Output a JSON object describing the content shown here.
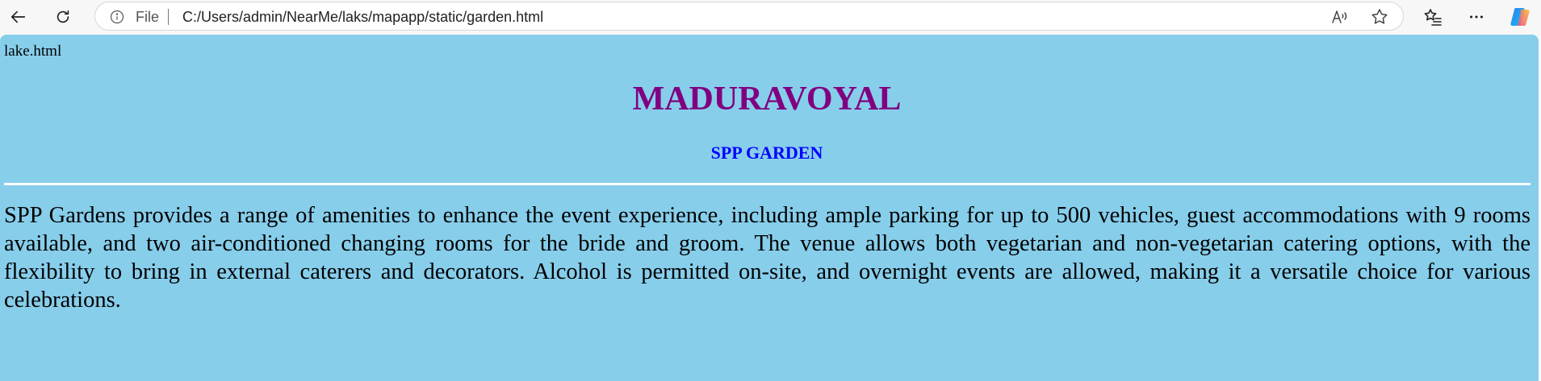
{
  "browser": {
    "file_label": "File",
    "url": "C:/Users/admin/NearMe/laks/mapapp/static/garden.html"
  },
  "page": {
    "filename": "lake.html",
    "title": "MADURAVOYAL",
    "subtitle": "SPP GARDEN",
    "body": "SPP Gardens provides a range of amenities to enhance the event experience, including ample parking for up to 500 vehicles, guest accommodations with 9 rooms available, and two air-conditioned changing rooms for the bride and groom. The venue allows both vegetarian and non-vegetarian catering options, with the flexibility to bring in external caterers and decorators. Alcohol is permitted on-site, and overnight events are allowed, making it a versatile choice for various celebrations."
  },
  "colors": {
    "page_background": "#87ceeb",
    "title": "#800080",
    "subtitle": "#0000ff",
    "rule": "#ffffff"
  },
  "icons": [
    "back-arrow-icon",
    "refresh-icon",
    "info-icon",
    "read-aloud-icon",
    "favorite-star-icon",
    "favorites-list-icon",
    "more-dots-icon",
    "copilot-icon"
  ]
}
